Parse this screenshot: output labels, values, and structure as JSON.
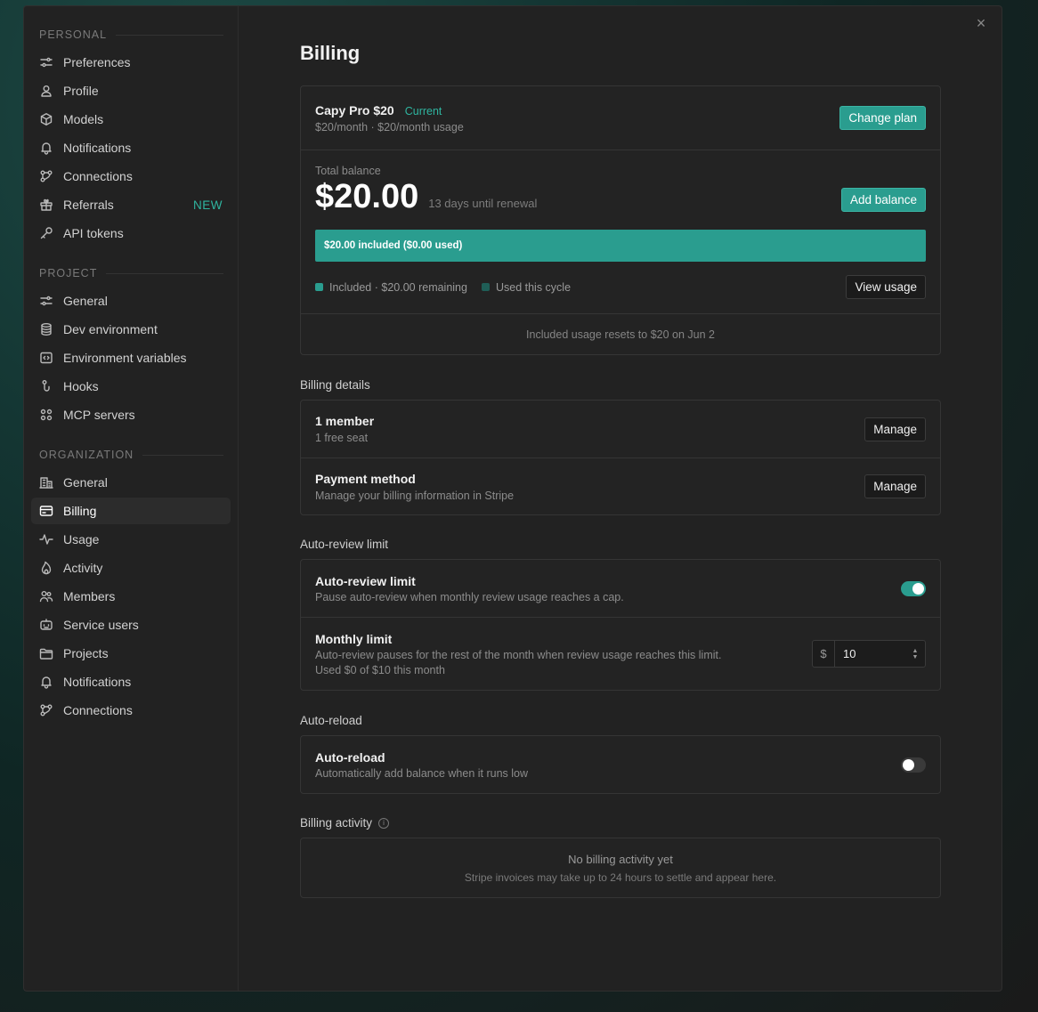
{
  "sidebar": {
    "personal": {
      "heading": "PERSONAL",
      "items": [
        {
          "label": "Preferences",
          "icon": "sliders-icon"
        },
        {
          "label": "Profile",
          "icon": "user-icon"
        },
        {
          "label": "Models",
          "icon": "cube-icon"
        },
        {
          "label": "Notifications",
          "icon": "bell-icon"
        },
        {
          "label": "Connections",
          "icon": "connections-icon"
        },
        {
          "label": "Referrals",
          "icon": "gift-icon",
          "badge": "NEW"
        },
        {
          "label": "API tokens",
          "icon": "key-icon"
        }
      ]
    },
    "project": {
      "heading": "PROJECT",
      "items": [
        {
          "label": "General",
          "icon": "sliders-icon"
        },
        {
          "label": "Dev environment",
          "icon": "database-icon"
        },
        {
          "label": "Environment variables",
          "icon": "code-icon"
        },
        {
          "label": "Hooks",
          "icon": "hook-icon"
        },
        {
          "label": "MCP servers",
          "icon": "grid-icon"
        }
      ]
    },
    "organization": {
      "heading": "ORGANIZATION",
      "items": [
        {
          "label": "General",
          "icon": "building-icon"
        },
        {
          "label": "Billing",
          "icon": "credit-card-icon",
          "active": true
        },
        {
          "label": "Usage",
          "icon": "activity-icon"
        },
        {
          "label": "Activity",
          "icon": "flame-icon"
        },
        {
          "label": "Members",
          "icon": "users-icon"
        },
        {
          "label": "Service users",
          "icon": "bot-icon"
        },
        {
          "label": "Projects",
          "icon": "folder-icon"
        },
        {
          "label": "Notifications",
          "icon": "bell-icon"
        },
        {
          "label": "Connections",
          "icon": "connections-icon"
        }
      ]
    }
  },
  "main": {
    "title": "Billing",
    "plan": {
      "name": "Capy Pro $20",
      "status": "Current",
      "detail": "$20/month · $20/month usage",
      "change_label": "Change plan"
    },
    "balance": {
      "label": "Total balance",
      "amount": "$20.00",
      "renewal": "13 days until renewal",
      "add_label": "Add balance",
      "bar_text": "$20.00 included ($0.00 used)",
      "included_used_fraction": 0.0,
      "legend_included": "Included · $20.00 remaining",
      "legend_used": "Used this cycle",
      "view_usage_label": "View usage",
      "reset_note": "Included usage resets to $20 on Jun 2"
    },
    "billing_details": {
      "heading": "Billing details",
      "members_title": "1 member",
      "members_sub": "1 free seat",
      "members_button": "Manage",
      "payment_title": "Payment method",
      "payment_sub": "Manage your billing information in Stripe",
      "payment_button": "Manage"
    },
    "auto_review": {
      "heading": "Auto-review limit",
      "toggle_title": "Auto-review limit",
      "toggle_sub": "Pause auto-review when monthly review usage reaches a cap.",
      "toggle_on": true,
      "limit_title": "Monthly limit",
      "limit_sub": "Auto-review pauses for the rest of the month when review usage reaches this limit.",
      "limit_used": "Used $0 of $10 this month",
      "currency": "$",
      "limit_value": "10"
    },
    "auto_reload": {
      "heading": "Auto-reload",
      "title": "Auto-reload",
      "sub": "Automatically add balance when it runs low",
      "toggle_on": false
    },
    "activity": {
      "heading": "Billing activity",
      "empty_title": "No billing activity yet",
      "empty_sub": "Stripe invoices may take up to 24 hours to settle and appear here."
    }
  },
  "colors": {
    "accent": "#2a9d8f",
    "accent_text": "#2fb5a0",
    "used_swatch": "#1f5e57"
  }
}
